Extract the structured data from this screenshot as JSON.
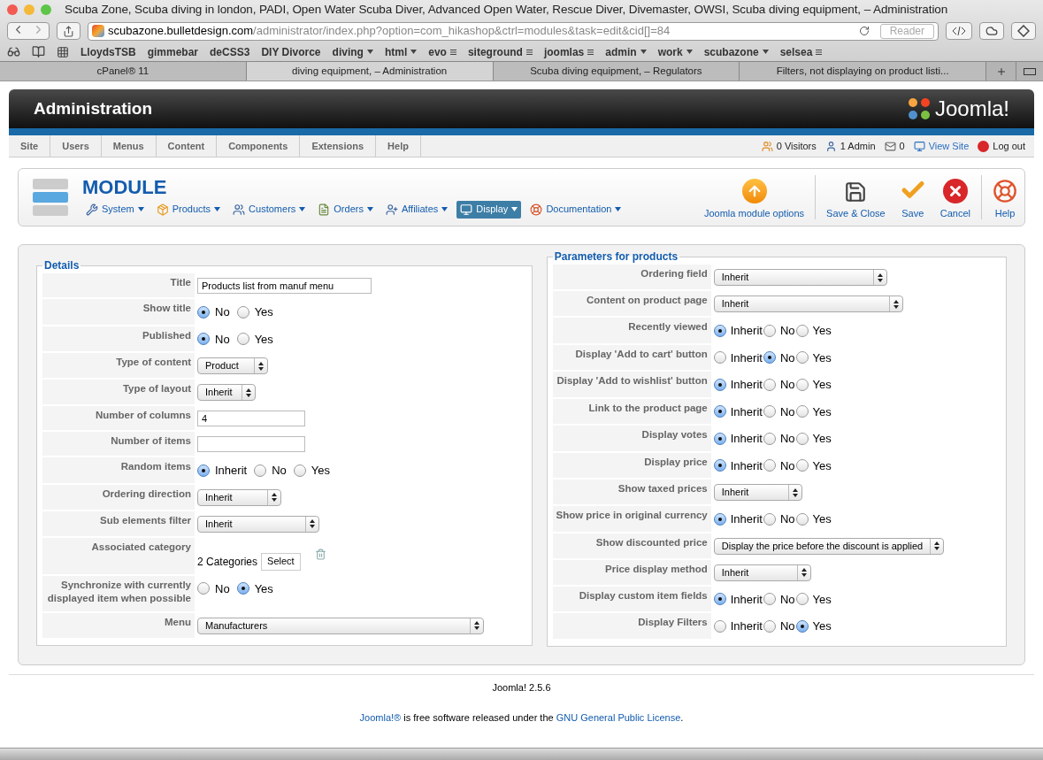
{
  "browser": {
    "title": "Scuba Zone, Scuba diving in london, PADI, Open Water Scuba Diver, Advanced Open Water, Rescue Diver, Divemaster, OWSI, Scuba diving equipment, – Administration",
    "url_host": "scubazone.bulletdesign.com",
    "url_path": "/administrator/index.php?option=com_hikashop&ctrl=modules&task=edit&cid[]=84",
    "reader": "Reader",
    "bookmarks": [
      {
        "label": "LloydsTSB",
        "kind": "plain"
      },
      {
        "label": "gimmebar",
        "kind": "plain"
      },
      {
        "label": "deCSS3",
        "kind": "plain"
      },
      {
        "label": "DIY Divorce",
        "kind": "plain"
      },
      {
        "label": "diving",
        "kind": "menu"
      },
      {
        "label": "html",
        "kind": "menu"
      },
      {
        "label": "evo",
        "kind": "list"
      },
      {
        "label": "siteground",
        "kind": "list"
      },
      {
        "label": "joomlas",
        "kind": "list"
      },
      {
        "label": "admin",
        "kind": "menu"
      },
      {
        "label": "work",
        "kind": "menu"
      },
      {
        "label": "scubazone",
        "kind": "menu"
      },
      {
        "label": "selsea",
        "kind": "list"
      }
    ],
    "tabs": [
      {
        "label": "cPanel® 11",
        "selected": false
      },
      {
        "label": "diving equipment, – Administration",
        "selected": true
      },
      {
        "label": "Scuba diving equipment, – Regulators",
        "selected": false
      },
      {
        "label": "Filters, not displaying on product listi...",
        "selected": false
      }
    ]
  },
  "header": {
    "title": "Administration",
    "logo": "Joomla!"
  },
  "menu": [
    "Site",
    "Users",
    "Menus",
    "Content",
    "Components",
    "Extensions",
    "Help"
  ],
  "status": [
    {
      "label": "0 Visitors",
      "kind": "visitors"
    },
    {
      "label": "1 Admin",
      "kind": "admin"
    },
    {
      "label": "0",
      "kind": "messages"
    },
    {
      "label": "View Site",
      "kind": "view"
    },
    {
      "label": "Log out",
      "kind": "logout"
    }
  ],
  "toolbar": {
    "title": "MODULE",
    "submenu": [
      {
        "label": "System",
        "kind": "system",
        "selected": false
      },
      {
        "label": "Products",
        "kind": "products",
        "selected": false
      },
      {
        "label": "Customers",
        "kind": "customers",
        "selected": false
      },
      {
        "label": "Orders",
        "kind": "orders",
        "selected": false
      },
      {
        "label": "Affiliates",
        "kind": "affiliates",
        "selected": false
      },
      {
        "label": "Display",
        "kind": "display",
        "selected": true
      },
      {
        "label": "Documentation",
        "kind": "documentation",
        "selected": false
      }
    ],
    "buttons": [
      {
        "label": "Joomla module options",
        "kind": "options"
      },
      {
        "label": "Save & Close",
        "kind": "save-close"
      },
      {
        "label": "Save",
        "kind": "save"
      },
      {
        "label": "Cancel",
        "kind": "cancel"
      },
      {
        "label": "Help",
        "kind": "help"
      }
    ]
  },
  "details": {
    "legend": "Details",
    "rows": [
      {
        "label": "Title",
        "kind": "text",
        "value": "Products list from manuf menu"
      },
      {
        "label": "Show title",
        "kind": "radio",
        "options": [
          {
            "label": "No",
            "selected": true
          },
          {
            "label": "Yes",
            "selected": false
          }
        ]
      },
      {
        "label": "Published",
        "kind": "radio",
        "options": [
          {
            "label": "No",
            "selected": true
          },
          {
            "label": "Yes",
            "selected": false
          }
        ]
      },
      {
        "label": "Type of content",
        "kind": "select",
        "value": "Product"
      },
      {
        "label": "Type of layout",
        "kind": "select",
        "value": "Inherit"
      },
      {
        "label": "Number of columns",
        "kind": "text",
        "value": "4"
      },
      {
        "label": "Number of items",
        "kind": "text"
      },
      {
        "label": "Random items",
        "kind": "radio",
        "options": [
          {
            "label": "Inherit",
            "selected": true
          },
          {
            "label": "No",
            "selected": false
          },
          {
            "label": "Yes",
            "selected": false
          }
        ]
      },
      {
        "label": "Ordering direction",
        "kind": "select",
        "value": "Inherit"
      },
      {
        "label": "Sub elements filter",
        "kind": "select",
        "value": "Inherit"
      },
      {
        "label": "Associated category",
        "kind": "categories",
        "value": "2 Categories",
        "button": "Select"
      },
      {
        "label": "Synchronize with currently displayed item when possible",
        "kind": "radio",
        "options": [
          {
            "label": "No",
            "selected": false
          },
          {
            "label": "Yes",
            "selected": true
          }
        ]
      },
      {
        "label": "Menu",
        "kind": "select",
        "value": "Manufacturers"
      }
    ]
  },
  "parameters": {
    "legend": "Parameters for products",
    "rows": [
      {
        "label": "Ordering field",
        "kind": "select",
        "value": "Inherit"
      },
      {
        "label": "Content on product page",
        "kind": "select",
        "value": "Inherit"
      },
      {
        "label": "Recently viewed",
        "kind": "radio",
        "options": [
          {
            "label": "Inherit",
            "selected": true
          },
          {
            "label": "No",
            "selected": false
          },
          {
            "label": "Yes",
            "selected": false
          }
        ]
      },
      {
        "label": "Display 'Add to cart' button",
        "kind": "radio",
        "options": [
          {
            "label": "Inherit",
            "selected": false
          },
          {
            "label": "No",
            "selected": true
          },
          {
            "label": "Yes",
            "selected": false
          }
        ]
      },
      {
        "label": "Display 'Add to wishlist' button",
        "kind": "radio",
        "options": [
          {
            "label": "Inherit",
            "selected": true
          },
          {
            "label": "No",
            "selected": false
          },
          {
            "label": "Yes",
            "selected": false
          }
        ]
      },
      {
        "label": "Link to the product page",
        "kind": "radio",
        "options": [
          {
            "label": "Inherit",
            "selected": true
          },
          {
            "label": "No",
            "selected": false
          },
          {
            "label": "Yes",
            "selected": false
          }
        ]
      },
      {
        "label": "Display votes",
        "kind": "radio",
        "options": [
          {
            "label": "Inherit",
            "selected": true
          },
          {
            "label": "No",
            "selected": false
          },
          {
            "label": "Yes",
            "selected": false
          }
        ]
      },
      {
        "label": "Display price",
        "kind": "radio",
        "options": [
          {
            "label": "Inherit",
            "selected": true
          },
          {
            "label": "No",
            "selected": false
          },
          {
            "label": "Yes",
            "selected": false
          }
        ]
      },
      {
        "label": "Show taxed prices",
        "kind": "select",
        "value": "Inherit"
      },
      {
        "label": "Show price in original currency",
        "kind": "radio",
        "options": [
          {
            "label": "Inherit",
            "selected": true
          },
          {
            "label": "No",
            "selected": false
          },
          {
            "label": "Yes",
            "selected": false
          }
        ]
      },
      {
        "label": "Show discounted price",
        "kind": "select",
        "value": "Display the price before the discount is applied"
      },
      {
        "label": "Price display method",
        "kind": "select",
        "value": "Inherit"
      },
      {
        "label": "Display custom item fields",
        "kind": "radio",
        "options": [
          {
            "label": "Inherit",
            "selected": true
          },
          {
            "label": "No",
            "selected": false
          },
          {
            "label": "Yes",
            "selected": false
          }
        ]
      },
      {
        "label": "Display Filters",
        "kind": "radio",
        "options": [
          {
            "label": "Inherit",
            "selected": false
          },
          {
            "label": "No",
            "selected": false
          },
          {
            "label": "Yes",
            "selected": true
          }
        ]
      }
    ]
  },
  "footer": {
    "version": "Joomla! 2.5.6",
    "link1": "Joomla!®",
    "text1": " is free software released under the ",
    "link2": "GNU General Public License",
    "text2": "."
  }
}
